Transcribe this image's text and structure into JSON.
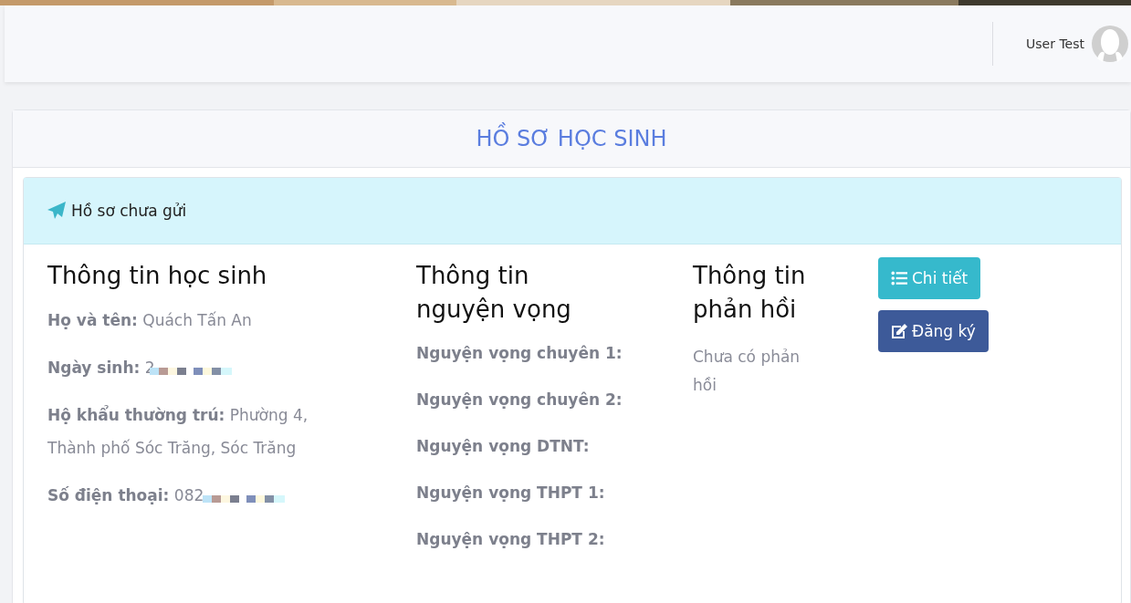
{
  "header": {
    "user_name": "User Test"
  },
  "page_title": "HỒ SƠ HỌC SINH",
  "status_alert": {
    "text": "Hồ sơ chưa gửi"
  },
  "student_info": {
    "heading": "Thông tin học sinh",
    "fields": [
      {
        "label": "Họ và tên:",
        "value": "Quách Tấn An",
        "redacted": false
      },
      {
        "label": "Ngày sinh:",
        "value": "2",
        "redacted": true
      },
      {
        "label": "Hộ khẩu thường trú:",
        "value": "Phường 4, Thành phố Sóc Trăng, Sóc Trăng",
        "redacted": false
      },
      {
        "label": "Số điện thoại:",
        "value": "082",
        "redacted": true
      }
    ]
  },
  "wishes_info": {
    "heading": "Thông tin nguyện vọng",
    "fields": [
      {
        "label": "Nguyện vọng chuyên 1:"
      },
      {
        "label": "Nguyện vọng chuyên 2:"
      },
      {
        "label": "Nguyện vọng DTNT:"
      },
      {
        "label": "Nguyện vọng THPT 1:"
      },
      {
        "label": "Nguyện vọng THPT 2:"
      }
    ]
  },
  "feedback_info": {
    "heading": "Thông tin phản hồi",
    "text": "Chưa có phản hồi"
  },
  "buttons": [
    {
      "kind": "details",
      "label": "Chi tiết"
    },
    {
      "kind": "register",
      "label": "Đăng ký"
    }
  ]
}
